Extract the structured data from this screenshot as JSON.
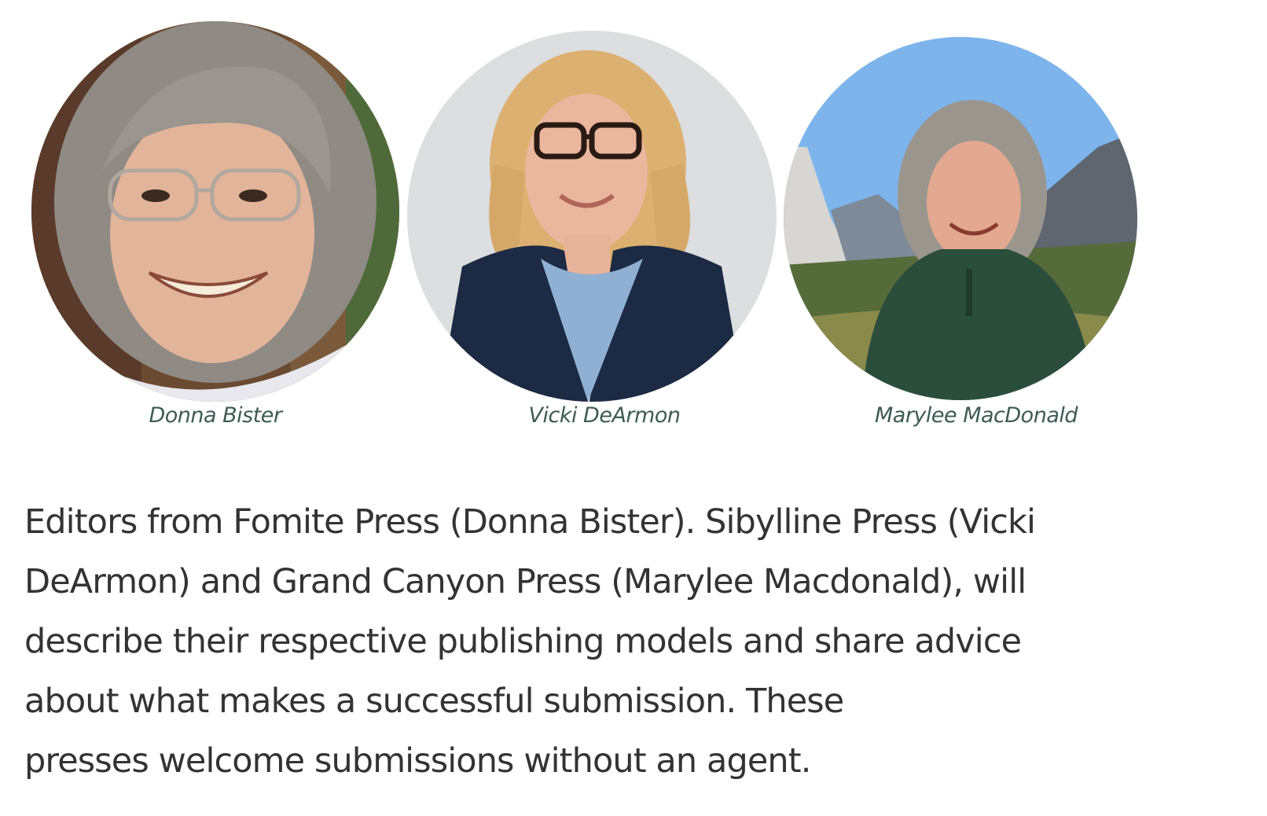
{
  "editors": [
    {
      "name": "Donna Bister",
      "portrait": "donna-bister-photo"
    },
    {
      "name": "Vicki DeArmon",
      "portrait": "vicki-dearmon-photo"
    },
    {
      "name": "Marylee MacDonald",
      "portrait": "marylee-macdonald-photo"
    }
  ],
  "description": {
    "lines": [
      "Editors from Fomite Press (Donna Bister). Sibylline Press (Vicki",
      "DeArmon) and Grand Canyon Press (Marylee Macdonald), will",
      "describe their respective publishing models and share advice",
      "about what makes a successful submission. These",
      "presses welcome submissions without an agent."
    ]
  },
  "colors": {
    "caption": "#3e5a54",
    "body_text": "#333333",
    "background": "#ffffff"
  }
}
